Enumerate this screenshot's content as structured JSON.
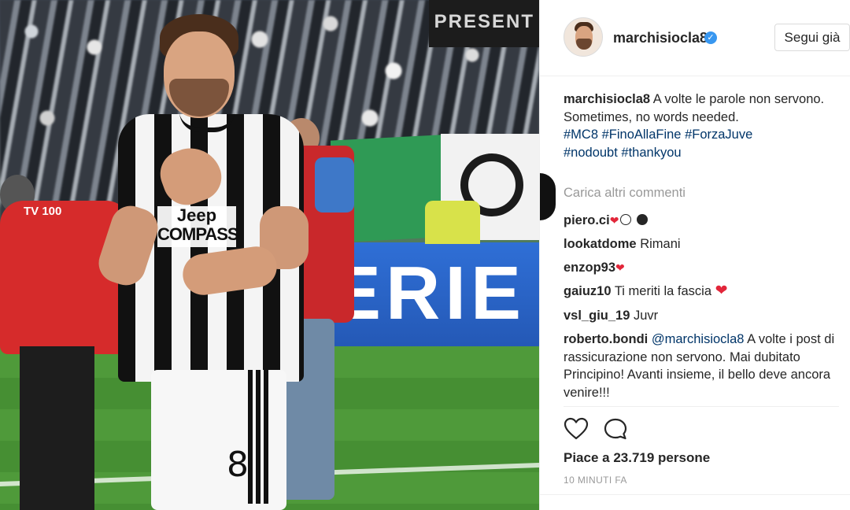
{
  "post": {
    "photo": {
      "banner_text": "PRESENT",
      "board_text": "ERIE",
      "tv_label": "TV 100",
      "sponsor_line1": "Jeep",
      "sponsor_line2": "COMPASS",
      "shorts_number": "8"
    },
    "header": {
      "username": "marchisiocla8",
      "verified_badge": "✓",
      "follow_button_label": "Segui già"
    },
    "caption": {
      "username": "marchisiocla8",
      "line1": "A volte le parole non servono.",
      "line2": "Sometimes, no words needed.",
      "hashtags_line1": "#MC8 #FinoAllaFine #ForzaJuve",
      "hashtags_line2": "#nodoubt #thankyou"
    },
    "load_more_label": "Carica altri commenti",
    "comments": [
      {
        "user": "piero.ci",
        "text": ""
      },
      {
        "user": "lookatdome",
        "text": "Rimani"
      },
      {
        "user": "enzop93",
        "text": ""
      },
      {
        "user": "gaiuz10",
        "text": "Ti meriti la fascia"
      },
      {
        "user": "vsl_giu_19",
        "text": "Juvr"
      },
      {
        "user": "roberto.bondi",
        "mention": "@marchisiocla8",
        "text": "A volte i post di rassicurazione non servono. Mai dubitato Principino! Avanti insieme, il bello deve ancora venire!!!"
      }
    ],
    "likes_text": "Piace a 23.719 persone",
    "timestamp": "10 MINUTI FA",
    "colors": {
      "link": "#003569",
      "verified": "#3897f0",
      "heart": "#e2263a",
      "muted": "#999999"
    },
    "icons": [
      "heart-outline-icon",
      "comment-bubble-icon",
      "verified-badge-icon"
    ]
  }
}
